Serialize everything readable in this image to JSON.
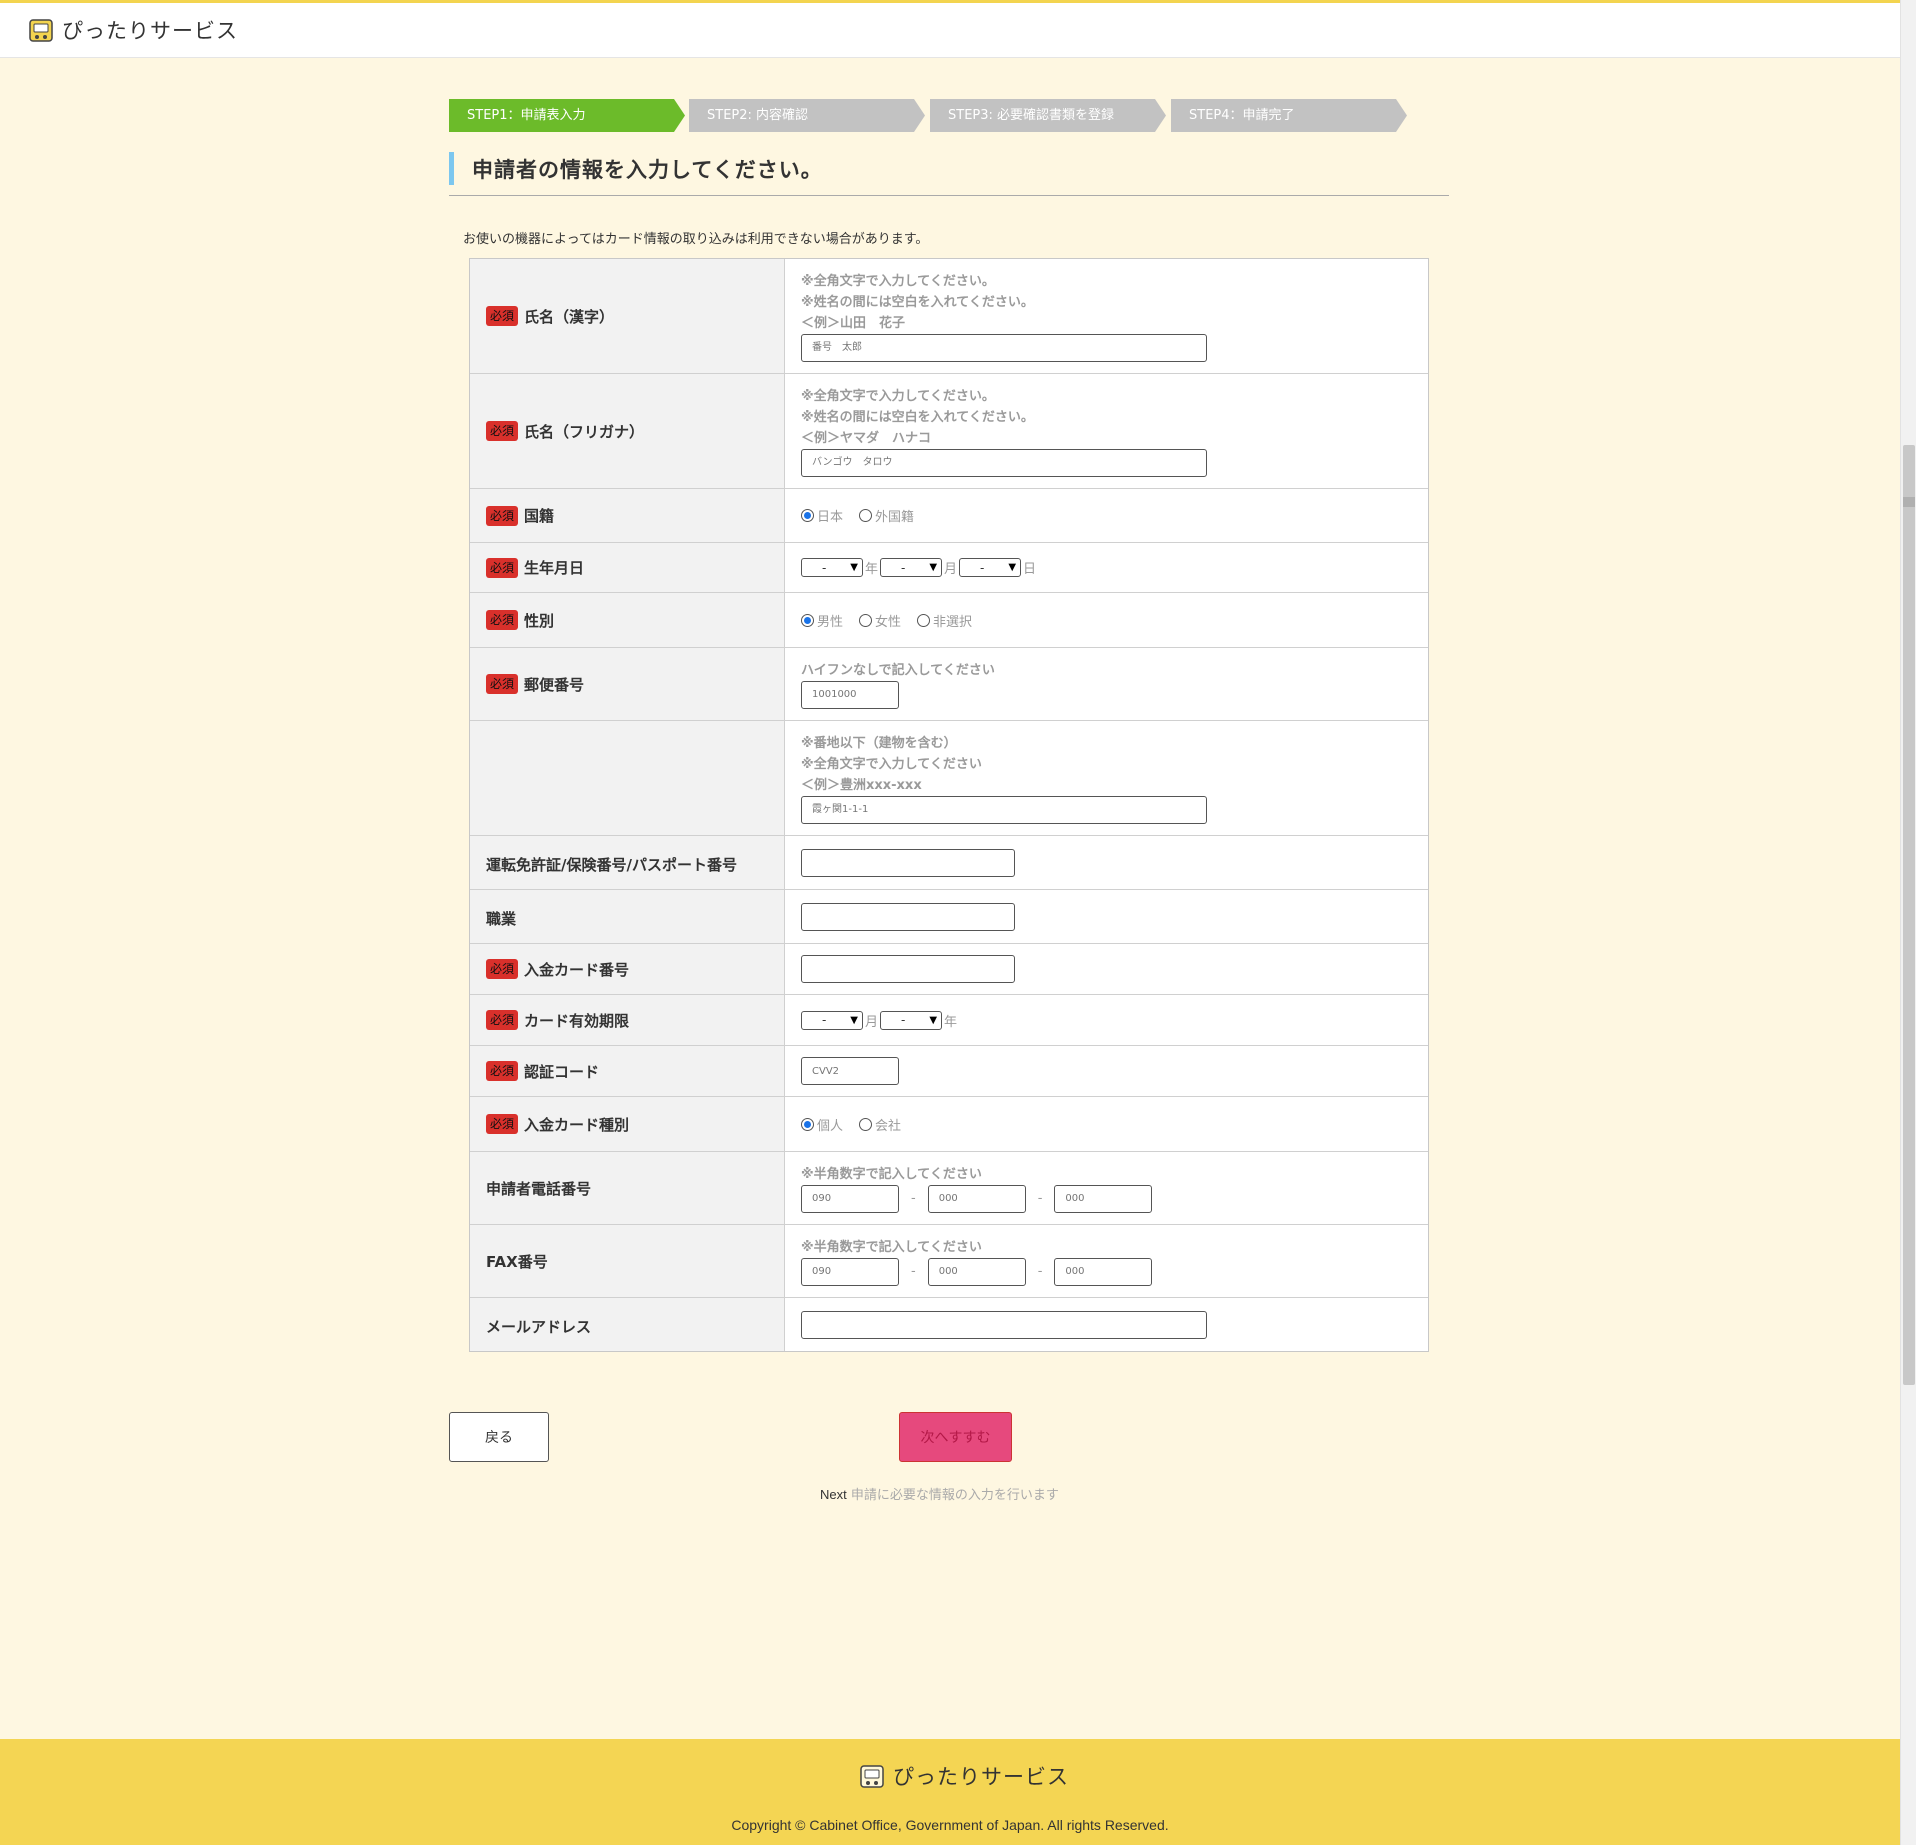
{
  "header": {
    "logo_text": "ぴったりサービス"
  },
  "steps": [
    {
      "label": "STEP1：申請表入力",
      "state": "active"
    },
    {
      "label": "STEP2: 内容確認",
      "state": "inactive"
    },
    {
      "label": "STEP3:  必要確認書類を登録",
      "state": "inactive"
    },
    {
      "label": "STEP4：申請完了",
      "state": "inactive"
    }
  ],
  "heading": "申請者の情報を入力してください。",
  "notice": "お使いの機器によってはカード情報の取り込みは利用できない場合があります。",
  "required_badge": "必須",
  "form": {
    "name_kanji": {
      "label": "氏名（漢字）",
      "hints": [
        "※全角文字で入力してください。",
        "※姓名の間には空白を入れてください。",
        "＜例＞山田　花子"
      ],
      "placeholder": "番号　太郎"
    },
    "name_kana": {
      "label": "氏名（フリガナ）",
      "hints": [
        "※全角文字で入力してください。",
        "※姓名の間には空白を入れてください。",
        "＜例＞ヤマダ　ハナコ"
      ],
      "placeholder": "バンゴウ　タロウ"
    },
    "nationality": {
      "label": "国籍",
      "options": [
        "日本",
        "外国籍"
      ],
      "selected": "日本"
    },
    "birthdate": {
      "label": "生年月日",
      "select_value": "-",
      "units": [
        "年",
        "月",
        "日"
      ]
    },
    "gender": {
      "label": "性別",
      "options": [
        "男性",
        "女性",
        "非選択"
      ],
      "selected": "男性"
    },
    "postal": {
      "label": "郵便番号",
      "hint": "ハイフンなしで記入してください",
      "placeholder": "1001000"
    },
    "address": {
      "hints": [
        "※番地以下（建物を含む）",
        "※全角文字で入力してください",
        "＜例＞豊洲xxx-xxx"
      ],
      "placeholder": "霞ヶ関1-1-1"
    },
    "license": {
      "label": "運転免許証/保険番号/パスポート番号"
    },
    "occupation": {
      "label": "職業"
    },
    "card_number": {
      "label": "入金カード番号"
    },
    "card_expiry": {
      "label": "カード有効期限",
      "select_value": "-",
      "units": [
        "月",
        "年"
      ]
    },
    "cvv": {
      "label": "認証コード",
      "placeholder": "CVV2"
    },
    "card_type": {
      "label": "入金カード種別",
      "options": [
        "個人",
        "会社"
      ],
      "selected": "個人"
    },
    "phone": {
      "label": "申請者電話番号",
      "hint": "※半角数字で記入してください",
      "placeholders": [
        "090",
        "000",
        "000"
      ],
      "separator": "-"
    },
    "fax": {
      "label": "FAX番号",
      "hint": "※半角数字で記入してください",
      "placeholders": [
        "090",
        "000",
        "000"
      ],
      "separator": "-"
    },
    "email": {
      "label": "メールアドレス"
    }
  },
  "buttons": {
    "back": "戻る",
    "next": "次へすすむ"
  },
  "next_description": {
    "lead": "Next",
    "text": "申請に必要な情報の入力を行います"
  },
  "footer": {
    "logo_text": "ぴったりサービス",
    "copyright": "Copyright © Cabinet Office, Government of Japan. All rights Reserved."
  },
  "colors": {
    "accent_green": "#6cbb2a",
    "required_red": "#d9302b",
    "next_pink": "#e6497d",
    "footer_yellow": "#f4d553"
  }
}
